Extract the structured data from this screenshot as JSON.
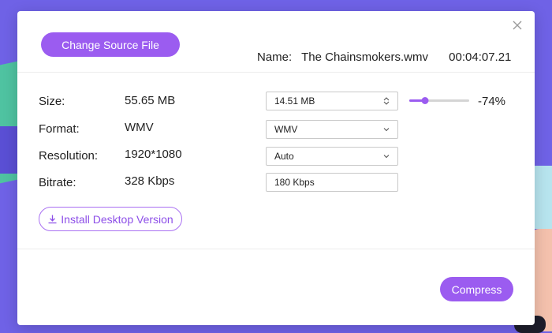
{
  "dialog": {
    "change_source_label": "Change Source File",
    "name_label": "Name:",
    "file_name": "The Chainsmokers.wmv",
    "duration": "00:04:07.21",
    "close_icon": "close-icon"
  },
  "rows": {
    "size": {
      "label": "Size:",
      "original": "55.65 MB",
      "target": "14.51  MB"
    },
    "format": {
      "label": "Format:",
      "original": "WMV",
      "target": "WMV"
    },
    "resolution": {
      "label": "Resolution:",
      "original": "1920*1080",
      "target": "Auto"
    },
    "bitrate": {
      "label": "Bitrate:",
      "original": "328 Kbps",
      "target": "180 Kbps"
    }
  },
  "compression": {
    "percent_label": "-74%",
    "slider_fraction": 0.26
  },
  "install_label": "Install Desktop Version",
  "compress_label": "Compress",
  "colors": {
    "accent": "#9b5cf0",
    "background": "#6f62e6"
  }
}
